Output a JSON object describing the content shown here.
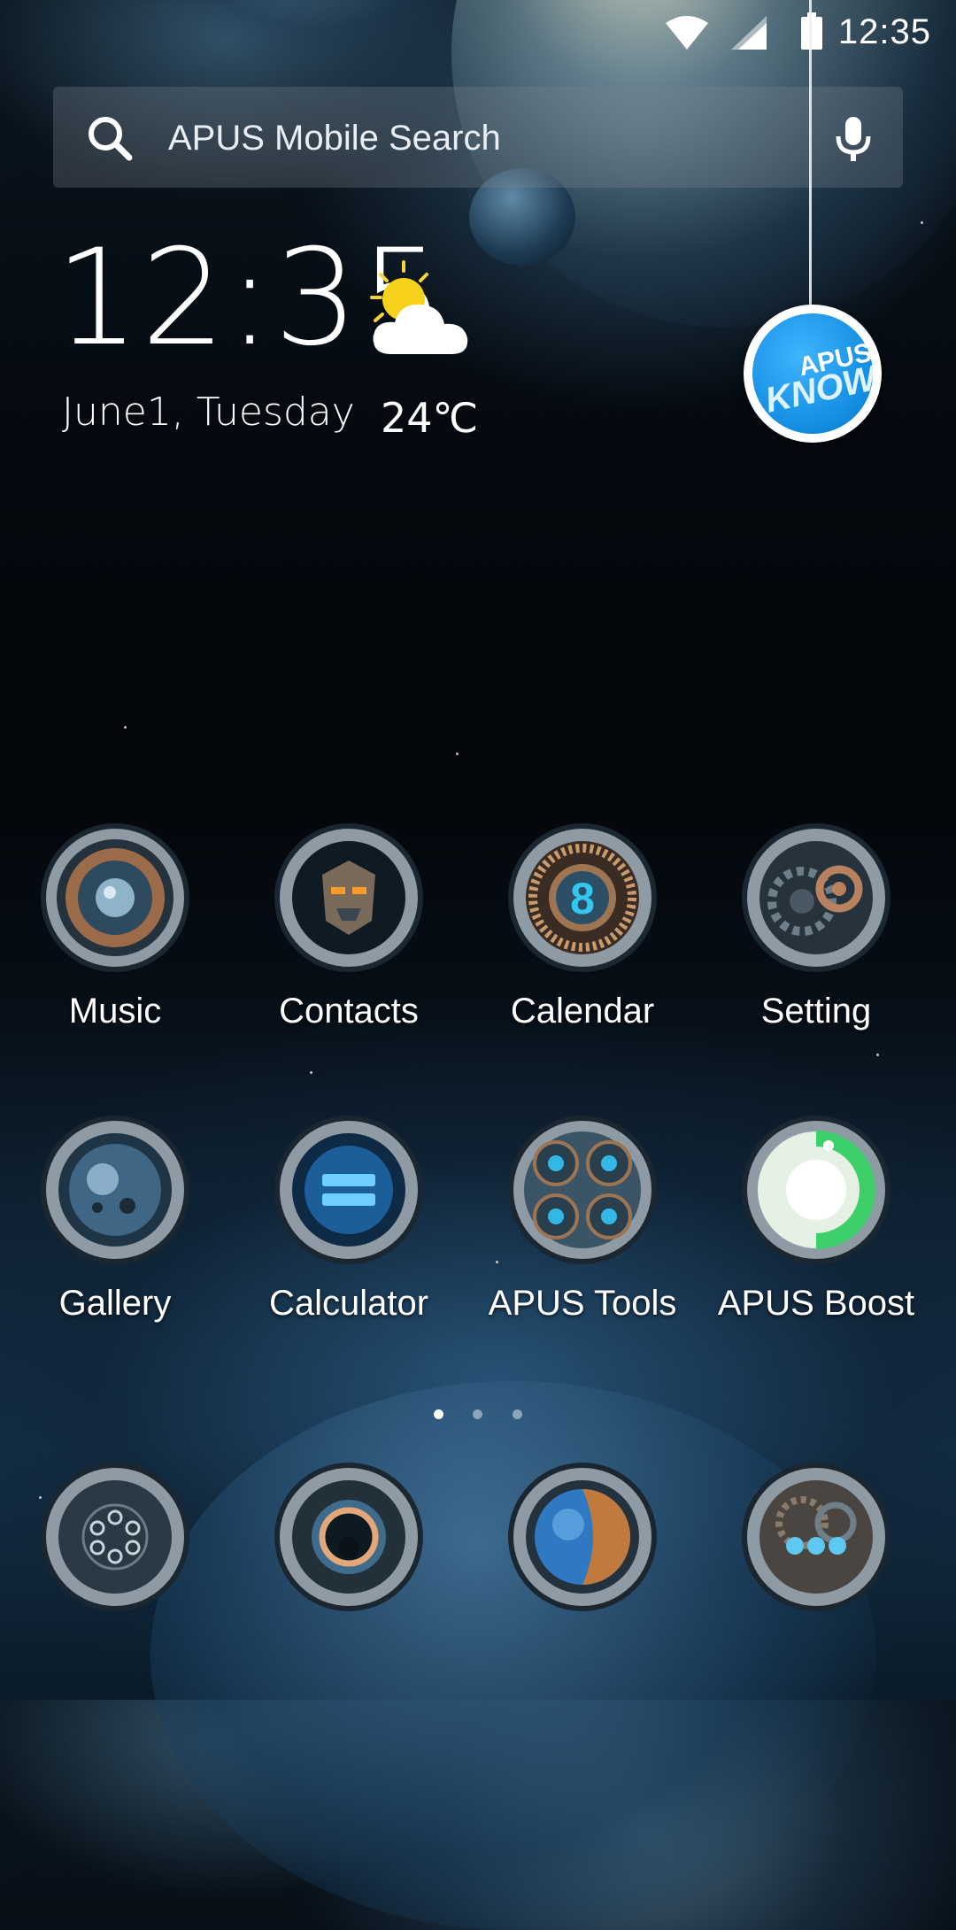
{
  "status_bar": {
    "time": "12:35",
    "icons": [
      "wifi-icon",
      "cell-signal-icon",
      "battery-icon"
    ]
  },
  "search": {
    "placeholder": "APUS Mobile Search",
    "icon": "search-icon",
    "voice_icon": "mic-icon"
  },
  "clock_widget": {
    "time": "12:35",
    "date": "June1, Tuesday",
    "temperature": "24℃",
    "weather_icon": "partly-sunny-icon"
  },
  "apus_know": {
    "line1": "APUS",
    "line2": "KNOW"
  },
  "apps": [
    {
      "label": "Music",
      "icon": "speaker-icon"
    },
    {
      "label": "Contacts",
      "icon": "robot-face-icon"
    },
    {
      "label": "Calendar",
      "icon": "calendar-8-icon"
    },
    {
      "label": "Setting",
      "icon": "gears-icon"
    },
    {
      "label": "Gallery",
      "icon": "planet-icon"
    },
    {
      "label": "Calculator",
      "icon": "calculator-icon"
    },
    {
      "label": "APUS Tools",
      "icon": "tools-icon"
    },
    {
      "label": "APUS Boost",
      "icon": "boost-icon"
    }
  ],
  "page_indicator": {
    "count": 3,
    "active": 1
  },
  "dock": [
    {
      "icon": "dialer-icon"
    },
    {
      "icon": "camera-icon"
    },
    {
      "icon": "browser-globe-icon"
    },
    {
      "icon": "messages-icon"
    }
  ],
  "colors": {
    "accent_blue": "#19a4ff",
    "boost_green": "#3ccf6a",
    "metal": "#8a96a0"
  }
}
